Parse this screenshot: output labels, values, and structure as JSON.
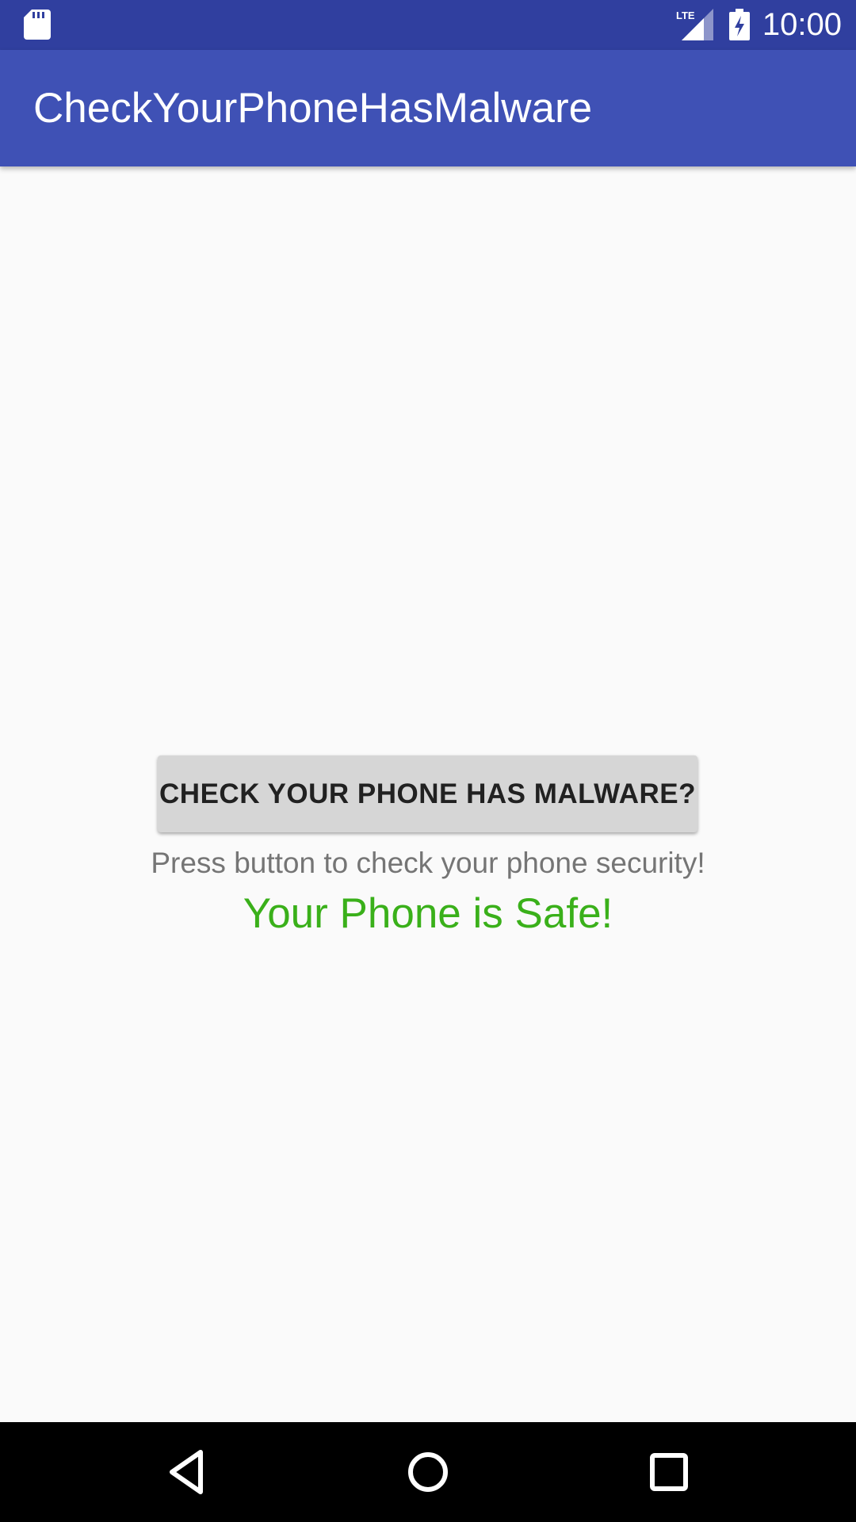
{
  "status_bar": {
    "time": "10:00",
    "network_label": "LTE",
    "icons": [
      "sd-card-icon",
      "lte-signal-icon",
      "battery-charging-icon"
    ]
  },
  "app_bar": {
    "title": "CheckYourPhoneHasMalware"
  },
  "main": {
    "check_button_label": "CHECK YOUR PHONE HAS MALWARE?",
    "hint_text": "Press button to check your phone security!",
    "result_text": "Your Phone is Safe!"
  },
  "nav_bar": {
    "icons": [
      "back-icon",
      "home-icon",
      "recents-icon"
    ]
  },
  "colors": {
    "status_bar": "#303f9f",
    "app_bar": "#3f51b5",
    "background": "#fafafa",
    "button": "#d6d6d6",
    "hint_text": "#757575",
    "result_safe": "#3ab01a",
    "nav_bar": "#000000"
  }
}
